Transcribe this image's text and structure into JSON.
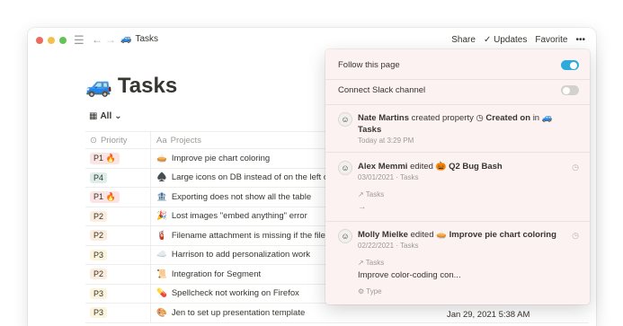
{
  "titlebar": {
    "page_emoji": "🚙",
    "page_name": "Tasks",
    "share": "Share",
    "updates": "Updates",
    "favorite": "Favorite",
    "more": "•••"
  },
  "page": {
    "emoji": "🚙",
    "title": "Tasks",
    "view": "All"
  },
  "table": {
    "headers": {
      "priority": "Priority",
      "projects": "Projects"
    },
    "rows": [
      {
        "priority": "P1 🔥",
        "color": "#fbe4e4",
        "emoji": "🥧",
        "project": "Improve pie chart coloring"
      },
      {
        "priority": "P4",
        "color": "#ddedea",
        "emoji": "♠️",
        "project": "Large icons on DB instead of on the left o"
      },
      {
        "priority": "P1 🔥",
        "color": "#fbe4e4",
        "emoji": "🏦",
        "project": "Exporting does not show all the table"
      },
      {
        "priority": "P2",
        "color": "#fbecdd",
        "emoji": "🎉",
        "project": "Lost images \"embed anything\" error"
      },
      {
        "priority": "P2",
        "color": "#fbecdd",
        "emoji": "🧯",
        "project": "Filename attachment is missing if the file"
      },
      {
        "priority": "P3",
        "color": "#fbf3db",
        "emoji": "☁️",
        "project": "Harrison to add personalization work"
      },
      {
        "priority": "P2",
        "color": "#fbecdd",
        "emoji": "📜",
        "project": "Integration for Segment"
      },
      {
        "priority": "P3",
        "color": "#fbf3db",
        "emoji": "💊",
        "project": "Spellcheck not working on Firefox"
      },
      {
        "priority": "P3",
        "color": "#fbf3db",
        "emoji": "🎨",
        "project": "Jen to set up presentation template"
      }
    ],
    "last_date": "Jan 29, 2021 5:38 AM"
  },
  "popup": {
    "follow_label": "Follow this page",
    "follow_on": true,
    "slack_label": "Connect Slack channel",
    "slack_on": false,
    "activity": [
      {
        "user": "Nate Martins",
        "action": "created property",
        "target": "◷ Created on",
        "prep": "in",
        "target2": "🚙 Tasks",
        "time": "Today at 3:29 PM"
      },
      {
        "user": "Alex Memmi",
        "action": "edited",
        "target": "🎃 Q2 Bug Bash",
        "date": "03/01/2021",
        "sep": "·",
        "db": "Tasks",
        "prop": "Tasks",
        "value": "→"
      },
      {
        "user": "Molly Mielke",
        "action": "edited",
        "target": "🥧 Improve pie chart coloring",
        "date": "02/22/2021",
        "sep": "·",
        "db": "Tasks",
        "prop": "Tasks",
        "value": "Improve color-coding con...",
        "prop2": "Type"
      }
    ]
  }
}
